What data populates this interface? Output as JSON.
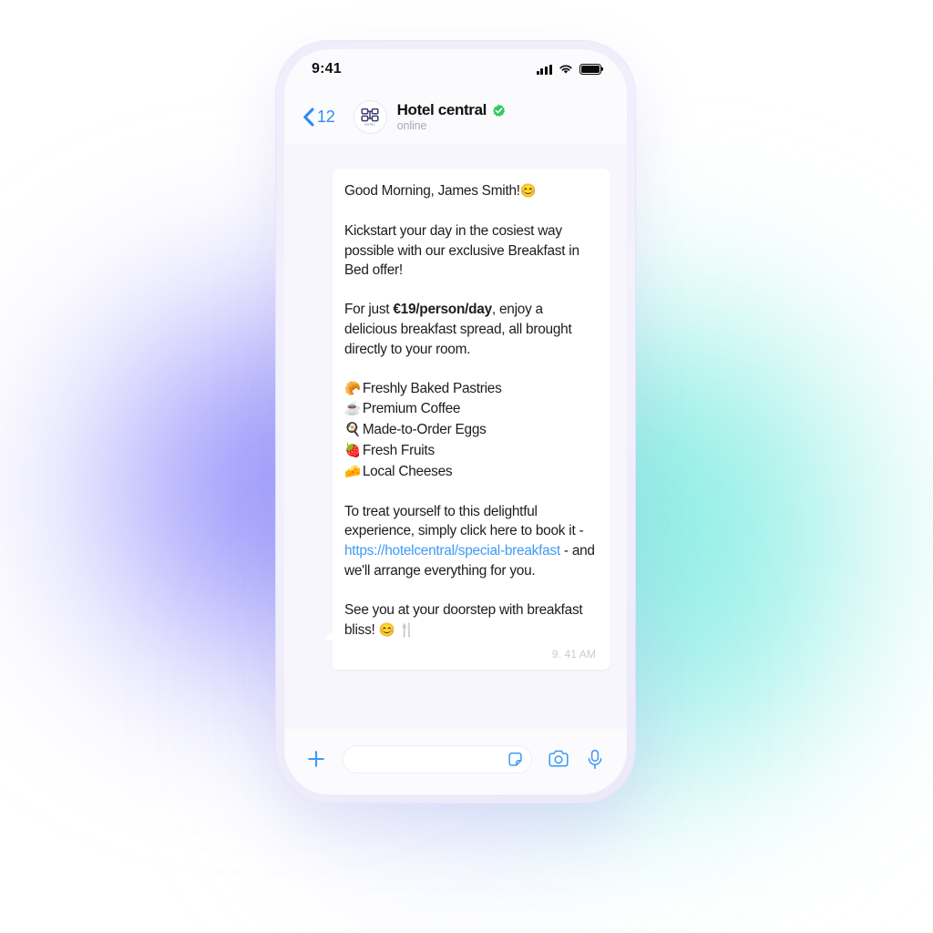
{
  "status_bar": {
    "time": "9:41",
    "signal_icon": "cellular-bars-icon",
    "wifi_icon": "wifi-icon",
    "battery_icon": "battery-full-icon"
  },
  "header": {
    "back_label": "12",
    "back_icon": "chevron-left-icon",
    "avatar_icon": "hotel-logo-avatar",
    "avatar_caption": "HOTEL",
    "contact_name": "Hotel central",
    "verified_icon": "verified-badge-icon",
    "verified_color": "#2ecc5f",
    "status": "online"
  },
  "message": {
    "greeting": "Good Morning, James Smith!",
    "greeting_emoji": "😊",
    "paragraph_1": "Kickstart your day in the cosiest way possible with our exclusive Breakfast in Bed offer!",
    "price_prefix": "For just ",
    "price": "€19/person/day",
    "price_suffix": ", enjoy a delicious breakfast spread, all brought directly to your room.",
    "items": [
      {
        "emoji": "🥐",
        "emoji_name": "croissant-emoji",
        "label": "Freshly Baked Pastries"
      },
      {
        "emoji": "☕",
        "emoji_name": "coffee-emoji",
        "label": "Premium Coffee"
      },
      {
        "emoji": "🍳",
        "emoji_name": "fried-egg-emoji",
        "label": "Made-to-Order Eggs"
      },
      {
        "emoji": "🍓",
        "emoji_name": "strawberry-emoji",
        "label": "Fresh Fruits"
      },
      {
        "emoji": "🧀",
        "emoji_name": "cheese-emoji",
        "label": "Local Cheeses"
      }
    ],
    "cta_prefix": "To treat yourself to this delightful experience, simply click here to book it - ",
    "cta_link": "https://hotelcentral/special-breakfast",
    "cta_suffix": " - and we'll arrange everything for you.",
    "closing": "See you at your doorstep with breakfast bliss! ",
    "closing_emoji_1": "😊",
    "closing_emoji_2": "🍴",
    "timestamp": "9. 41 AM",
    "link_color": "#3d9bf5"
  },
  "input_bar": {
    "plus_icon": "plus-icon",
    "input_placeholder": "",
    "input_value": "",
    "sticker_icon": "sticker-icon",
    "camera_icon": "camera-icon",
    "mic_icon": "microphone-icon",
    "accent_color": "#3d9bf5"
  }
}
